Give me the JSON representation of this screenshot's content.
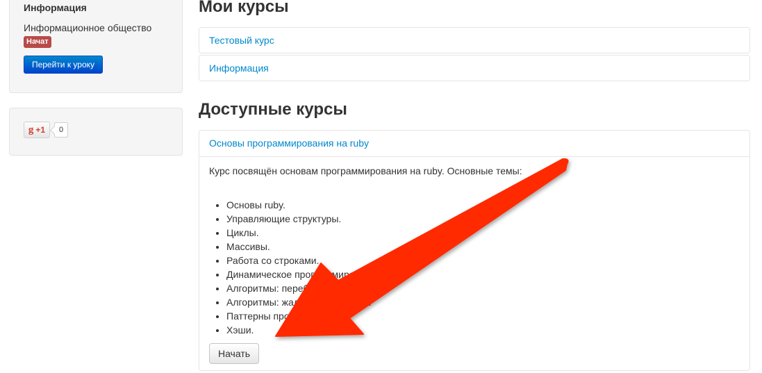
{
  "sidebar": {
    "current": {
      "heading": "Информация",
      "course_name": "Информационное общество",
      "status_badge": "Начат",
      "go_button": "Перейти к уроку"
    },
    "share": {
      "plus_label": "+1",
      "count": "0",
      "icon": "google-g-icon"
    }
  },
  "main": {
    "my_courses": {
      "title": "Мои курсы",
      "items": [
        "Тестовый курс",
        "Информация"
      ]
    },
    "available": {
      "title": "Доступные курсы",
      "course": {
        "title": "Основы программирования на ruby",
        "description": "Курс посвящён основам программирования на ruby. Основные темы:",
        "topics": [
          "Основы ruby.",
          "Управляющие структуры.",
          "Циклы.",
          "Массивы.",
          "Работа со строками.",
          "Динамическое программирование.",
          "Алгоритмы: перебор.",
          "Алгоритмы: жадные алгоритмы.",
          "Паттерны проектирования.",
          "Хэши."
        ],
        "start_button": "Начать"
      }
    }
  },
  "colors": {
    "link": "#0088cc",
    "badge_important": "#b94a48",
    "primary_button": "#0055cc",
    "annotation_arrow": "#ff2a00"
  }
}
